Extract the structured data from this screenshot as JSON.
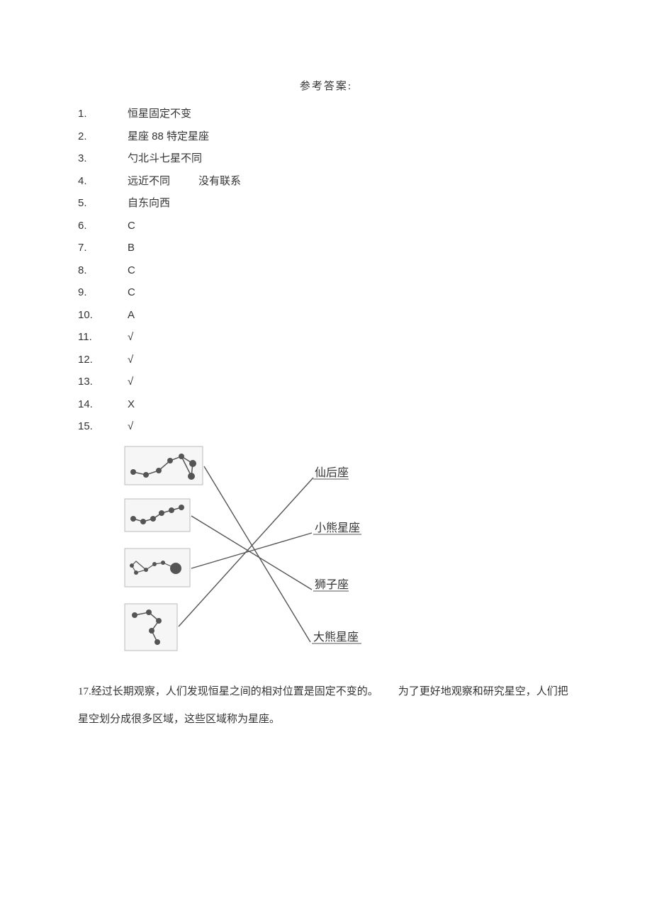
{
  "title": "参考答案:",
  "answers": [
    {
      "n": "1.",
      "v": "恒星固定不变"
    },
    {
      "n": "2.",
      "v": "星座 88 特定星座"
    },
    {
      "n": "3.",
      "v": "勺北斗七星不同"
    },
    {
      "n": "4.",
      "v": "远近不同",
      "v2": "没有联系"
    },
    {
      "n": "5.",
      "v": "自东向西"
    },
    {
      "n": "6.",
      "v": "C"
    },
    {
      "n": "7.",
      "v": "B"
    },
    {
      "n": "8.",
      "v": "C"
    },
    {
      "n": "9.",
      "v": "C"
    },
    {
      "n": "10.",
      "v": "A"
    },
    {
      "n": "11.",
      "v": "√"
    },
    {
      "n": "12.",
      "v": "√"
    },
    {
      "n": "13.",
      "v": "√"
    },
    {
      "n": "14.",
      "v": "X"
    },
    {
      "n": "15.",
      "v": "√"
    }
  ],
  "diagram": {
    "labels": {
      "r1": "仙后座",
      "r2": "小熊星座",
      "r3": "狮子座",
      "r4": "大熊星座"
    }
  },
  "para17_a": "17.经过长期观察，人们发现恒星之间的相对位置是固定不变的。",
  "para17_b": "为了更好地观察和研究星空，人们把星空划分成很多区域，这些区域称为星座。"
}
